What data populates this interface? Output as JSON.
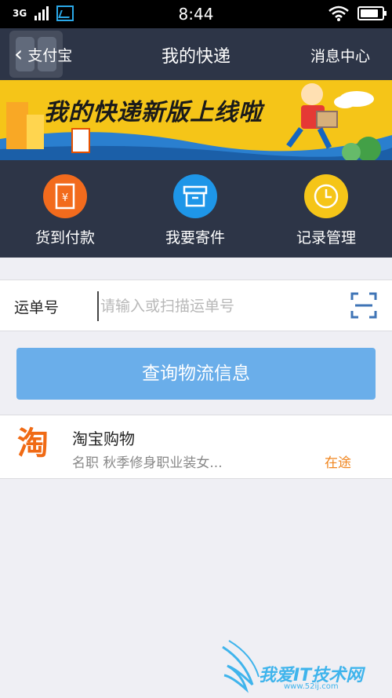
{
  "status_bar": {
    "carrier_glyph": "3G",
    "time": "8:44",
    "battery_level": 0.85
  },
  "nav": {
    "back_label": "支付宝",
    "title": "我的快递",
    "right_label": "消息中心"
  },
  "banner": {
    "text": "我的快递新版上线啦"
  },
  "actions": [
    {
      "label": "货到付款",
      "icon": "cash-on-delivery-icon",
      "color": "#f26b1d"
    },
    {
      "label": "我要寄件",
      "icon": "box-icon",
      "color": "#1e96e8"
    },
    {
      "label": "记录管理",
      "icon": "clock-icon",
      "color": "#f5c518"
    }
  ],
  "waybill": {
    "label": "运单号",
    "value": "",
    "placeholder": "请输入或扫描运单号"
  },
  "query_button": "查询物流信息",
  "records": [
    {
      "logo": "淘",
      "title": "淘宝购物",
      "description": "名职 秋季修身职业装女...",
      "status": "在途"
    }
  ],
  "watermark": {
    "text": "我爱IT技术网",
    "url": "www.52ij.com"
  },
  "colors": {
    "nav_bg": "#2d3547",
    "accent_blue": "#6aaeea",
    "status_orange": "#f0851e",
    "banner_yellow": "#f5c518"
  }
}
